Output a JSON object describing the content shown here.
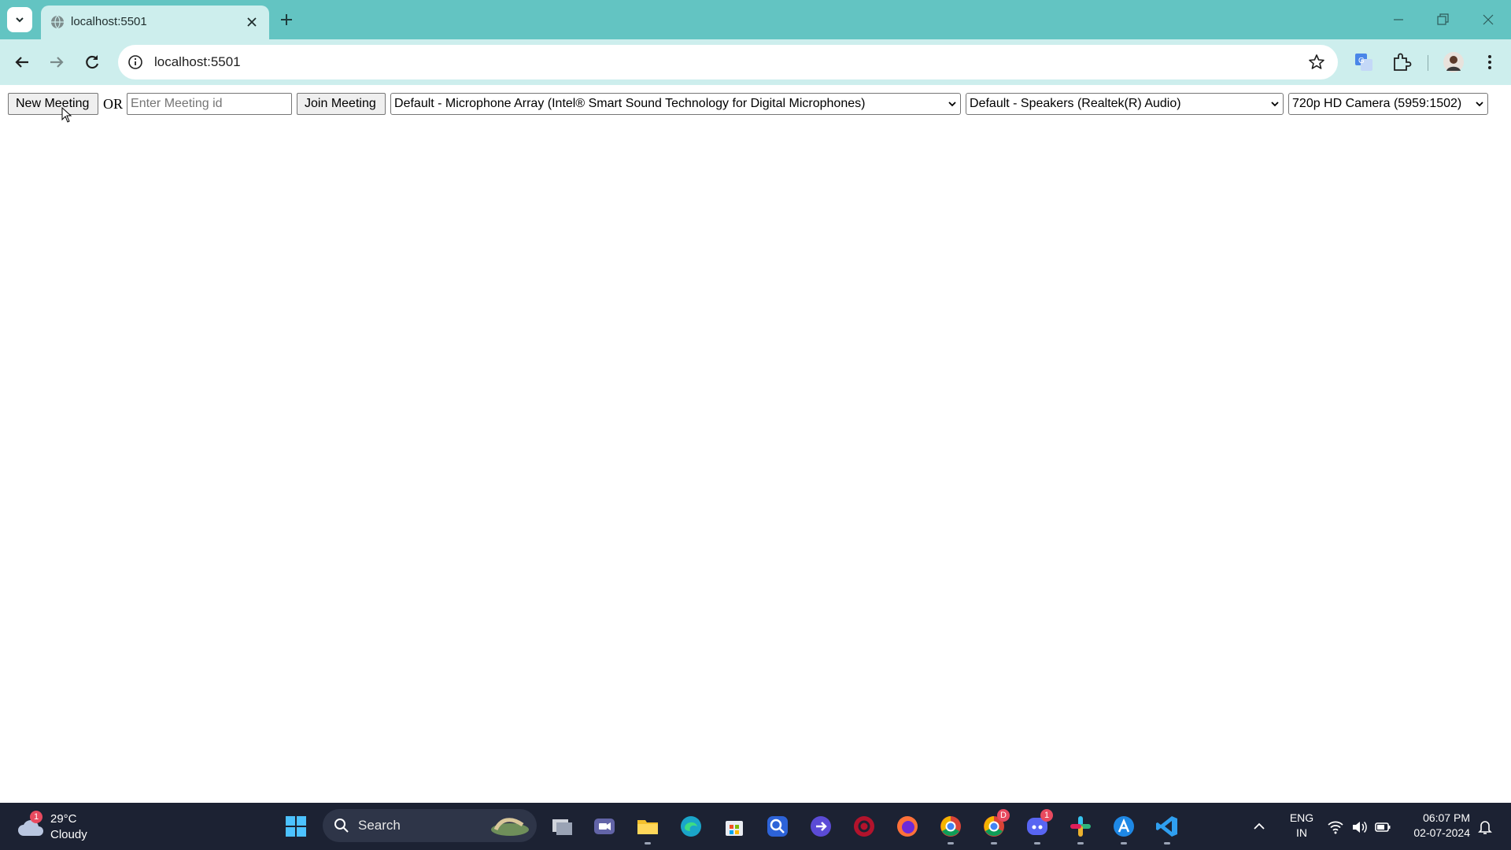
{
  "browser": {
    "tab_title": "localhost:5501",
    "url": "localhost:5501"
  },
  "page": {
    "new_meeting_label": "New Meeting",
    "or_label": "OR",
    "meeting_id_placeholder": "Enter Meeting id",
    "join_meeting_label": "Join Meeting",
    "microphone_selected": "Default - Microphone Array (Intel® Smart Sound Technology for Digital Microphones)",
    "speaker_selected": "Default - Speakers (Realtek(R) Audio)",
    "camera_selected": "720p HD Camera (5959:1502)"
  },
  "taskbar": {
    "weather_temp": "29°C",
    "weather_desc": "Cloudy",
    "weather_badge": "1",
    "search_label": "Search",
    "discord_badge": "1",
    "chrome_badge": "D",
    "lang_line1": "ENG",
    "lang_line2": "IN",
    "time": "06:07 PM",
    "date": "02-07-2024"
  },
  "colors": {
    "tabstrip": "#63c4c2",
    "toolbar": "#cdeeed",
    "taskbar": "#1c2233"
  }
}
